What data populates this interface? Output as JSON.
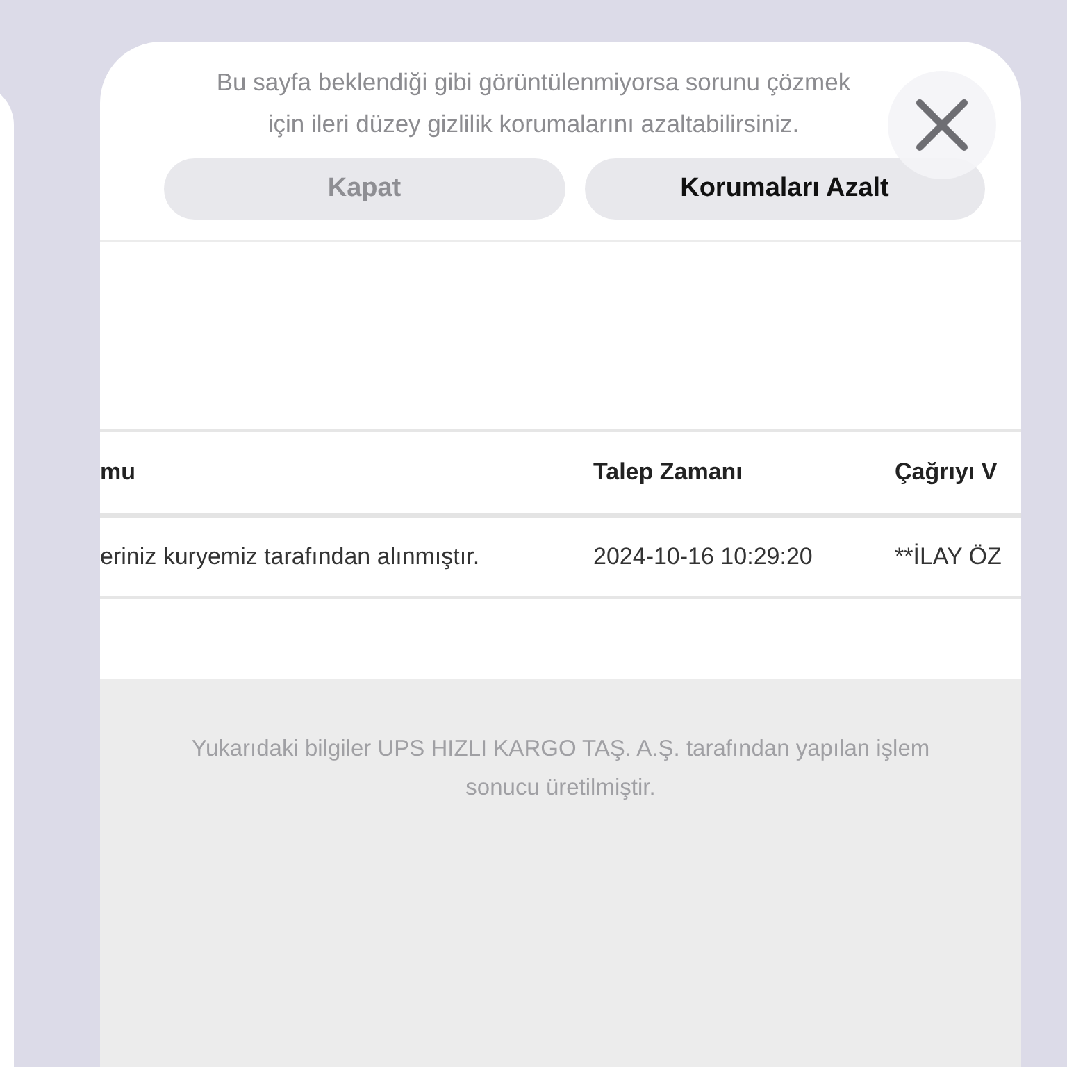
{
  "notice": {
    "text": "Bu sayfa beklendiği gibi görüntülenmiyorsa sorunu çözmek için ileri düzey gizlilik korumalarını azaltabilirsiniz.",
    "buttons": [
      {
        "label": "Kapat",
        "kind": "secondary"
      },
      {
        "label": "Korumaları Azalt",
        "kind": "primary"
      }
    ]
  },
  "table": {
    "columns": [
      "mu",
      "Talep Zamanı",
      "Çağrıyı V"
    ],
    "rows": [
      [
        "eriniz kuryemiz tarafından alınmıştır.",
        "2024-10-16 10:29:20",
        "**İLAY ÖZ"
      ]
    ]
  },
  "footer": {
    "text": "Yukarıdaki bilgiler UPS HIZLI KARGO TAŞ. A.Ş. tarafından yapılan işlem sonucu üretilmiştir."
  }
}
